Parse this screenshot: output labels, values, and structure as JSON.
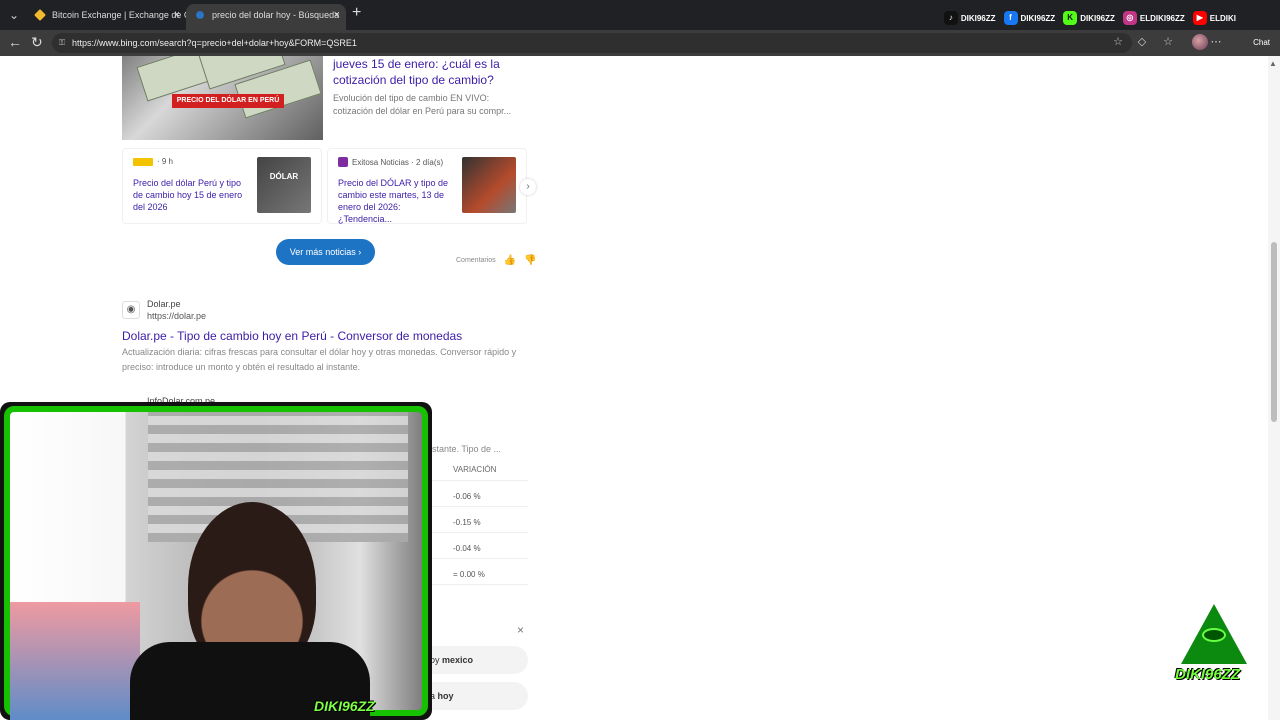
{
  "browser": {
    "tabs": [
      {
        "label": "Bitcoin Exchange | Exchange de C..."
      },
      {
        "label": "precio del dolar hoy - Búsqueda"
      }
    ],
    "url": "https://www.bing.com/search?q=precio+del+dolar+hoy&FORM=QSRE1",
    "chat_label": "Chat"
  },
  "social": [
    {
      "label": "DIKI96ZZ",
      "color": "#111111",
      "icon": "tiktok-icon"
    },
    {
      "label": "DIKI96ZZ",
      "color": "#1877f2",
      "icon": "facebook-icon"
    },
    {
      "label": "DIKI96ZZ",
      "color": "#53fc18",
      "icon": "kick-icon"
    },
    {
      "label": "ELDIKI96ZZ",
      "color": "#c13584",
      "icon": "instagram-icon"
    },
    {
      "label": "ELDIKI",
      "color": "#ff0000",
      "icon": "youtube-icon"
    }
  ],
  "hero": {
    "image_band": "PRECIO DEL DÓLAR EN PERÚ",
    "title": "jueves 15 de enero: ¿cuál es la cotización del tipo de cambio?",
    "description": "Evolución del tipo de cambio EN VIVO: cotización del dólar en Perú para su compr..."
  },
  "news": [
    {
      "source": "· 9 h",
      "title": "Precio del dólar Perú y tipo de cambio hoy 15 de enero del 2026",
      "thumb": "DÓLAR"
    },
    {
      "source": "Exitosa Noticias · 2 día(s)",
      "title": "Precio del DÓLAR y tipo de cambio este martes, 13 de enero del 2026: ¿Tendencia...",
      "thumb": ""
    }
  ],
  "more_news": "Ver más noticias",
  "feedback": "Comentarios",
  "result": {
    "site": "Dolar.pe",
    "url": "https://dolar.pe",
    "title": "Dolar.pe - Tipo de cambio hoy en Perú - Conversor de monedas",
    "description": "Actualización diaria: cifras frescas para consultar el dólar hoy y otras monedas. Conversor rápido y preciso: introduce un monto y obtén el resultado al instante."
  },
  "result2": {
    "site": "InfoDolar.com.pe",
    "snippet": "stante. Tipo de ..."
  },
  "table": {
    "header": "VARIACIÓN",
    "rows": [
      "-0.06 %",
      "-0.15 %",
      "-0.04 %",
      "= 0.00 %"
    ]
  },
  "related": [
    {
      "prefix": "oy ",
      "bold": "mexico"
    },
    {
      "prefix": "a ",
      "bold": "hoy"
    }
  ],
  "stream": {
    "badge": "DIKI96ZZ",
    "logo_text": "DIKI96ZZ",
    "frame_color": "#16c200"
  }
}
